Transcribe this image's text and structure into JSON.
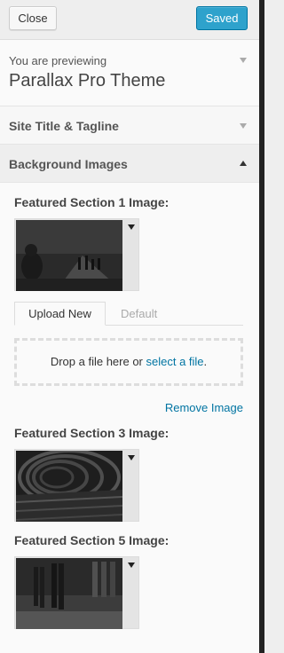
{
  "toolbar": {
    "close_label": "Close",
    "saved_label": "Saved"
  },
  "preview": {
    "label": "You are previewing",
    "theme_name": "Parallax Pro Theme"
  },
  "sections": {
    "site_title": "Site Title & Tagline",
    "background_images": "Background Images"
  },
  "controls": {
    "featured1": {
      "title": "Featured Section 1 Image:"
    },
    "upload_tabs": {
      "upload_new": "Upload New",
      "default": "Default"
    },
    "dropzone": {
      "text": "Drop a file here or ",
      "link": "select a file",
      "suffix": "."
    },
    "remove_image": "Remove Image",
    "featured3": {
      "title": "Featured Section 3 Image:"
    },
    "featured5": {
      "title": "Featured Section 5 Image:"
    }
  },
  "colors": {
    "accent": "#2ea2cc",
    "link": "#0074a2"
  }
}
